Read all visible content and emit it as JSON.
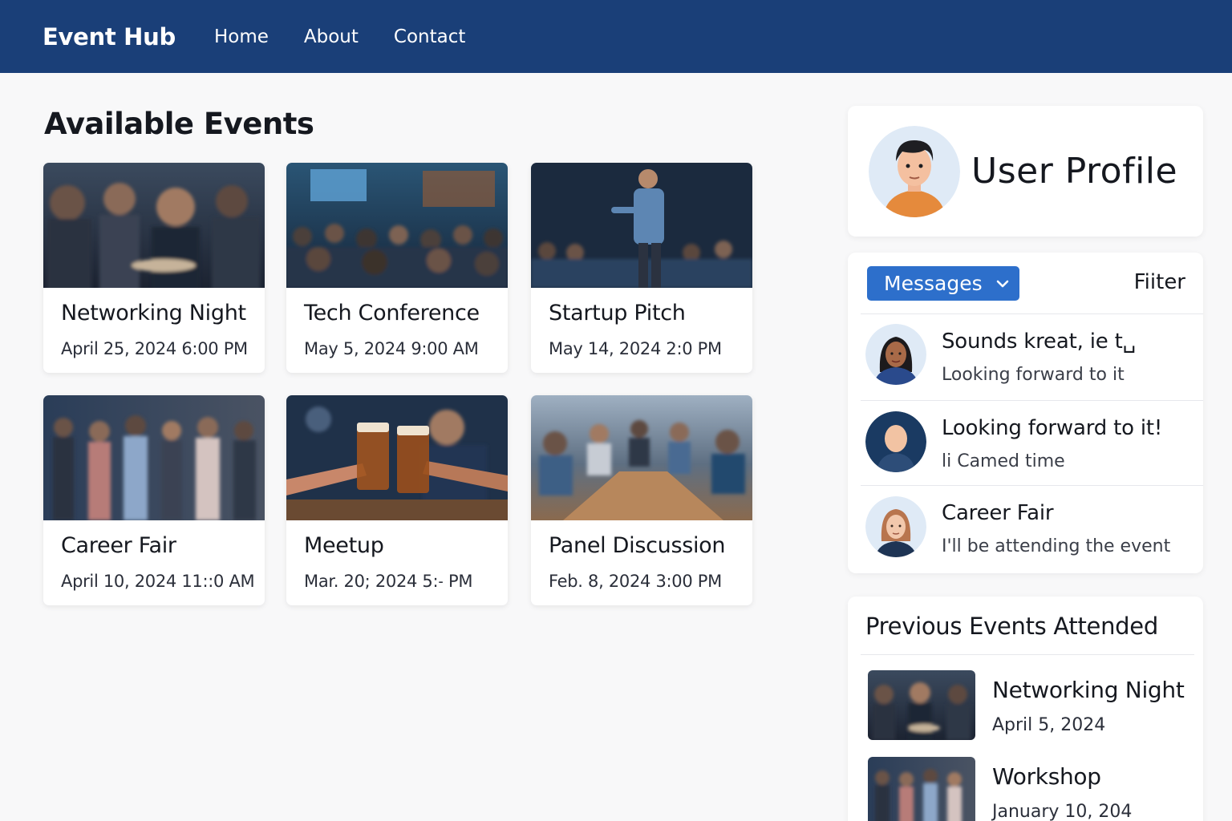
{
  "app": {
    "brand": "Event Hub"
  },
  "nav": [
    {
      "label": "Home"
    },
    {
      "label": "About"
    },
    {
      "label": "Contact"
    }
  ],
  "main": {
    "title": "Available Events",
    "events": [
      {
        "name": "Networking Night",
        "date": "April 25, 2024  6:00 PM",
        "image": "networking-crowd-photo"
      },
      {
        "name": "Tech Conference",
        "date": "May 5, 2024  9:00 AM",
        "image": "conference-audience-photo"
      },
      {
        "name": "Startup Pitch",
        "date": "May 14, 2024  2:0 PM",
        "image": "presenter-speaking-photo"
      },
      {
        "name": "Career Fair",
        "date": "April 10, 2024  11::0 AM",
        "image": "career-fair-crowd-photo"
      },
      {
        "name": "Meetup",
        "date": "Mar. 20; 2024  5:˗ PM",
        "image": "beer-toast-photo"
      },
      {
        "name": "Panel Discussion",
        "date": "Feb. 8, 2024  3:00 PM",
        "image": "meeting-table-photo"
      }
    ]
  },
  "profile": {
    "title": "User Profile",
    "avatar": "user-avatar"
  },
  "messages": {
    "button_label": "Messages",
    "filter_label": "Fiiter",
    "items": [
      {
        "title": "Sounds kreat, ie t␣",
        "subtitle": "Looking forward to it",
        "avatar": "woman-dark-hair-avatar"
      },
      {
        "title": "Looking forward to it!",
        "subtitle": "li Camed time",
        "avatar": "generic-person-avatar"
      },
      {
        "title": "Career Fair",
        "subtitle": "I'll be attending the event",
        "avatar": "woman-auburn-hair-avatar"
      }
    ]
  },
  "previous_events": {
    "title": "Previous Events Attended",
    "items": [
      {
        "name": "Networking Night",
        "date": "April 5, 2024",
        "image": "networking-crowd-photo"
      },
      {
        "name": "Workshop",
        "date": "January 10, 204",
        "image": "career-fair-crowd-photo"
      }
    ]
  },
  "colors": {
    "header_bg": "#1a3f78",
    "accent_blue": "#2d6fcb",
    "page_bg": "#f8f8f9",
    "card_bg": "#ffffff"
  }
}
